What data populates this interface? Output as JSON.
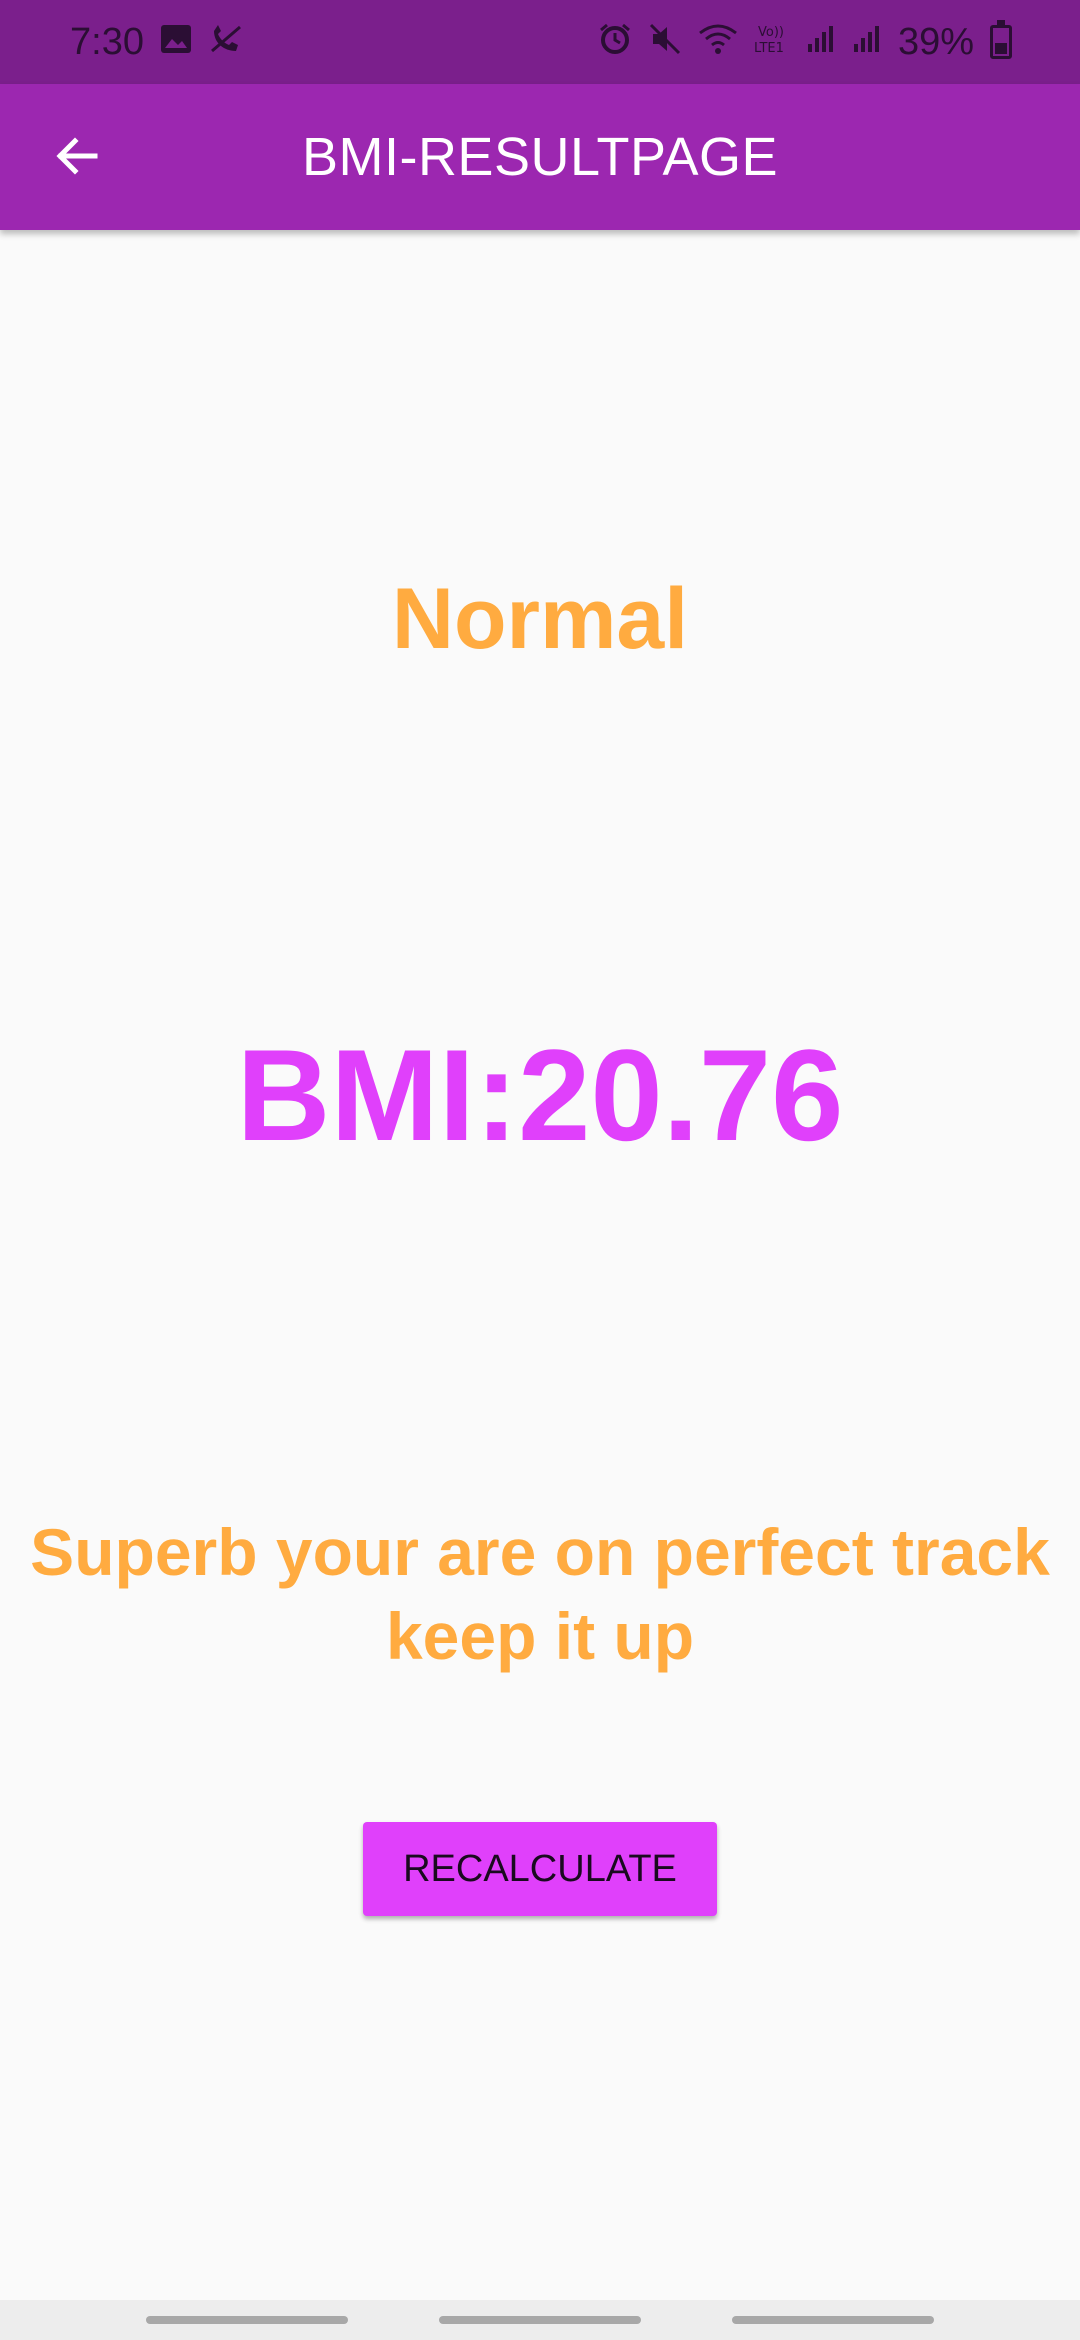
{
  "status_bar": {
    "time": "7:30",
    "battery_percent": "39%",
    "icons": [
      "image-icon",
      "no-call-icon",
      "alarm-icon",
      "mute-icon",
      "wifi-icon",
      "volte-icon",
      "signal-icon",
      "signal-icon",
      "battery-icon"
    ]
  },
  "app_bar": {
    "title": "BMI-RESULTPAGE",
    "back_icon": "arrow-back-icon",
    "color": "#9c27b0"
  },
  "result": {
    "category": "Normal",
    "bmi_text": "BMI:20.76",
    "message": "Superb your are on perfect track keep it up",
    "category_color": "#ffab40",
    "bmi_color": "#e040fb"
  },
  "actions": {
    "recalculate_label": "RECALCULATE"
  }
}
